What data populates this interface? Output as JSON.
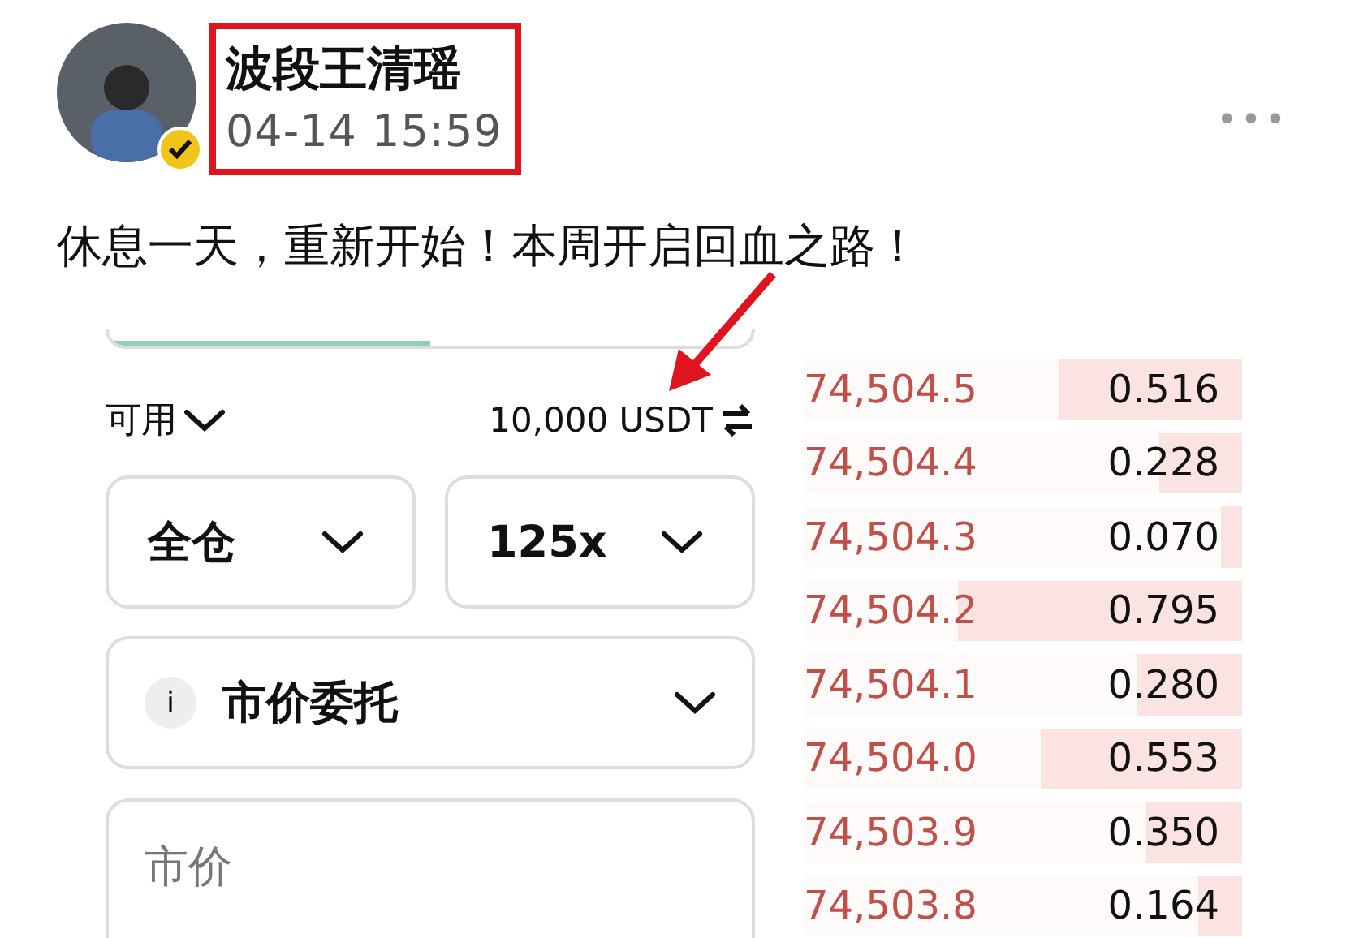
{
  "post": {
    "author": "波段王清瑶",
    "verified": true,
    "time": "04-14 15:59",
    "more": "•••",
    "text": "休息一天，重新开始！本周开启回血之路！"
  },
  "trade_panel": {
    "side_toggle": {
      "level": 0.5
    },
    "available_label": "可用",
    "balance": "10,000 USDT",
    "selects": [
      {
        "value": "全仓"
      },
      {
        "value": "125x"
      }
    ],
    "order_type": {
      "info": "i",
      "value": "市价委托"
    },
    "price_field": {
      "placeholder": "市价"
    }
  },
  "order_book": [
    {
      "price": "74,504.5",
      "amount": "0.516",
      "level": 0.42
    },
    {
      "price": "74,504.4",
      "amount": "0.228",
      "level": 0.19
    },
    {
      "price": "74,504.3",
      "amount": "0.070",
      "level": 0.05
    },
    {
      "price": "74,504.2",
      "amount": "0.795",
      "level": 0.65
    },
    {
      "price": "74,504.1",
      "amount": "0.280",
      "level": 0.24
    },
    {
      "price": "74,504.0",
      "amount": "0.553",
      "level": 0.46
    },
    {
      "price": "74,503.9",
      "amount": "0.350",
      "level": 0.22
    },
    {
      "price": "74,503.8",
      "amount": "0.164",
      "level": 0.1
    }
  ]
}
